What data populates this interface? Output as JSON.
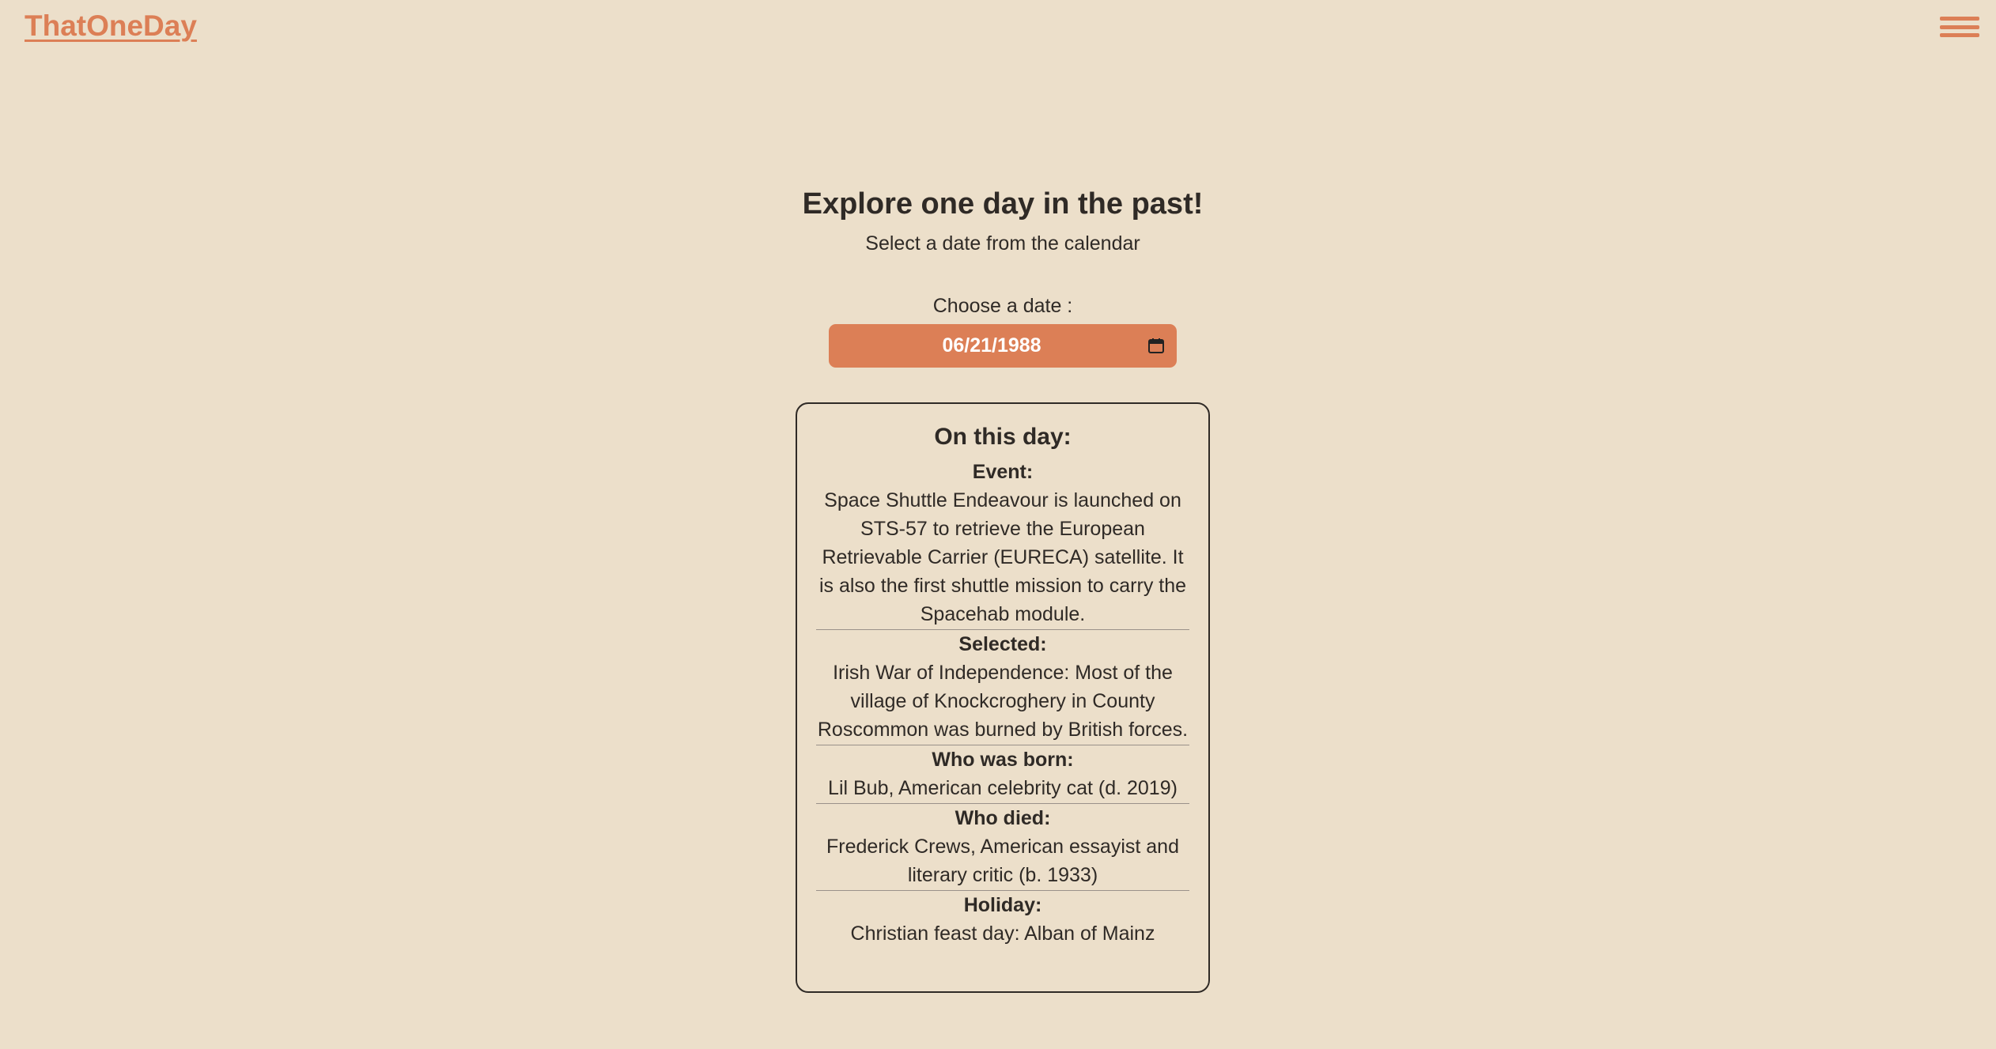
{
  "header": {
    "logo": "ThatOneDay"
  },
  "hero": {
    "title": "Explore one day in the past!",
    "subtitle": "Select a date from the calendar"
  },
  "date": {
    "label": "Choose a date :",
    "value": "06/21/1988"
  },
  "card": {
    "title": "On this day:",
    "sections": [
      {
        "title": "Event:",
        "text": "Space Shuttle Endeavour is launched on STS-57 to retrieve the European Retrievable Carrier (EURECA) satellite. It is also the first shuttle mission to carry the Spacehab module."
      },
      {
        "title": "Selected:",
        "text": "Irish War of Independence: Most of the village of Knockcroghery in County Roscommon was burned by British forces."
      },
      {
        "title": "Who was born:",
        "text": "Lil Bub, American celebrity cat (d. 2019)"
      },
      {
        "title": "Who died:",
        "text": "Frederick Crews, American essayist and literary critic (b. 1933)"
      },
      {
        "title": "Holiday:",
        "text": "Christian feast day: Alban of Mainz"
      }
    ]
  },
  "colors": {
    "background": "#ecdfca",
    "accent": "#dc7f56",
    "text": "#2f2a26"
  },
  "icons": {
    "menu": "hamburger-menu-icon",
    "calendar": "calendar-icon"
  }
}
